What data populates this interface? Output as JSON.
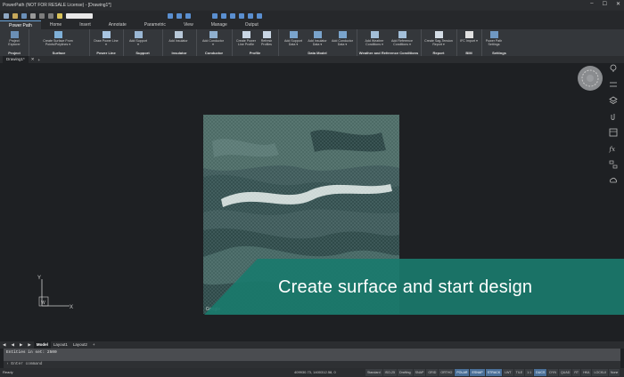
{
  "window": {
    "title": "PowerPath (NOT FOR RESALE License) - [Drawing1*]",
    "controls": [
      "–",
      "☐",
      "✕"
    ]
  },
  "ribbon_tabs": [
    {
      "label": "Power Path",
      "active": true
    },
    {
      "label": "Home"
    },
    {
      "label": "Insert"
    },
    {
      "label": "Annotate"
    },
    {
      "label": "Parametric"
    },
    {
      "label": "View"
    },
    {
      "label": "Manage"
    },
    {
      "label": "Output"
    }
  ],
  "ribbon": {
    "groups": [
      {
        "name": "Project",
        "buttons": [
          "Project Explorer"
        ]
      },
      {
        "name": "Surface",
        "buttons": [
          "Create Surface From Points/Polylines ▾"
        ]
      },
      {
        "name": "Power Line",
        "buttons": [
          "Draw Power Line ▾"
        ]
      },
      {
        "name": "Support",
        "buttons": [
          "Add Support ▾"
        ]
      },
      {
        "name": "Insulator",
        "buttons": [
          "Add Insulator"
        ]
      },
      {
        "name": "Conductor",
        "buttons": [
          "Add Conductor ▾"
        ]
      },
      {
        "name": "Profile",
        "buttons": [
          "Create Power Line Profile",
          "Refresh Profiles"
        ]
      },
      {
        "name": "Data Model",
        "buttons": [
          "Add Support Data ▾",
          "Add Insulator Data ▾",
          "Add Conductor Data ▾"
        ]
      },
      {
        "name": "Weather and Reference Conditions",
        "buttons": [
          "Add Weather Conditions ▾",
          "Add Reference Conditions ▾"
        ]
      },
      {
        "name": "Report",
        "buttons": [
          "Create Sag-Tension Report ▾"
        ]
      },
      {
        "name": "BIM",
        "buttons": [
          "IFC Import ▾"
        ]
      },
      {
        "name": "Settings",
        "buttons": [
          "Power Path Settings"
        ]
      }
    ]
  },
  "document_tab": "Drawing1*",
  "canvas": {
    "banner_text": "Create surface and start design",
    "ucs": {
      "y_label": "Y",
      "w_label": "W",
      "x_label": "X"
    },
    "terrain_watermark": "Google"
  },
  "layout_tabs": [
    "Model",
    "Layout1",
    "Layout2"
  ],
  "command_line": {
    "history": "Entities in set: 2500",
    "prompt": "Enter command"
  },
  "status_bar": {
    "state": "Ready",
    "coordinates": "409930.73, 1400312.58, 0",
    "items": [
      {
        "label": "Standard",
        "on": false
      },
      {
        "label": "ISO-25",
        "on": false
      },
      {
        "label": "Drafting",
        "on": false
      },
      {
        "label": "SNAP",
        "on": false
      },
      {
        "label": "GRID",
        "on": false
      },
      {
        "label": "ORTHO",
        "on": false
      },
      {
        "label": "POLAR",
        "on": true
      },
      {
        "label": "ESNAP",
        "on": true
      },
      {
        "label": "STRACK",
        "on": true
      },
      {
        "label": "LWT",
        "on": false
      },
      {
        "label": "TILE",
        "on": false
      },
      {
        "label": "1:1",
        "on": false
      },
      {
        "label": "DUCS",
        "on": true
      },
      {
        "label": "DYN",
        "on": false
      },
      {
        "label": "QUAD",
        "on": false
      },
      {
        "label": "RT",
        "on": false
      },
      {
        "label": "HKA",
        "on": false
      },
      {
        "label": "LOCKUI",
        "on": false
      },
      {
        "label": "None",
        "on": false
      }
    ]
  },
  "colors": {
    "accent": "#1a7a6c",
    "background": "#1e2023",
    "ribbon": "#34373b"
  }
}
